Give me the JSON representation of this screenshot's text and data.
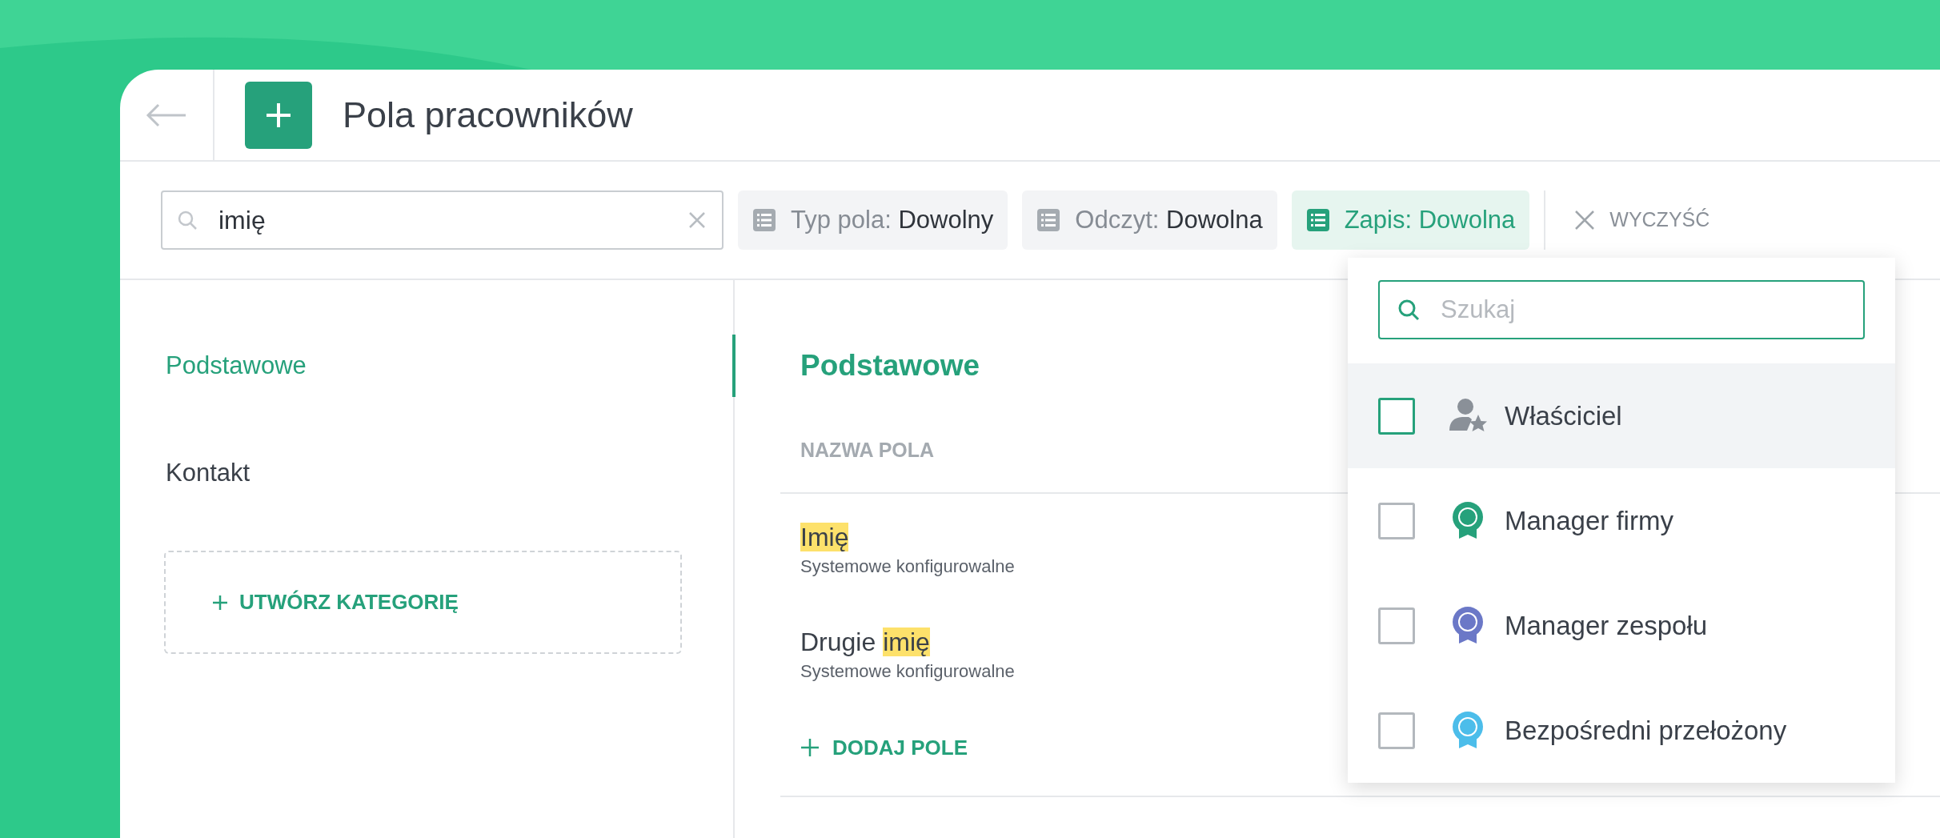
{
  "header": {
    "title": "Pola pracowników"
  },
  "filters": {
    "search": {
      "value": "imię"
    },
    "chips": [
      {
        "label": "Typ pola:",
        "value": "Dowolny",
        "active": false
      },
      {
        "label": "Odczyt:",
        "value": "Dowolna",
        "active": false
      },
      {
        "label": "Zapis:",
        "value": "Dowolna",
        "active": true
      }
    ],
    "clear": "WYCZYŚĆ"
  },
  "sidebar": {
    "items": [
      {
        "label": "Podstawowe",
        "selected": true
      },
      {
        "label": "Kontakt",
        "selected": false
      }
    ],
    "create": "UTWÓRZ KATEGORIĘ"
  },
  "section": {
    "title": "Podstawowe",
    "column": "NAZWA POLA",
    "rows": [
      {
        "name": [
          {
            "text": "Imię",
            "highlight": true
          }
        ],
        "subtitle": "Systemowe konfigurowalne"
      },
      {
        "name": [
          {
            "text": "Drugie ",
            "highlight": false
          },
          {
            "text": "imię",
            "highlight": true
          }
        ],
        "subtitle": "Systemowe konfigurowalne"
      }
    ],
    "add": "DODAJ POLE"
  },
  "dropdown": {
    "search": {
      "placeholder": "Szukaj"
    },
    "options": [
      {
        "label": "Właściciel",
        "kind": "owner",
        "color": "#8a9098",
        "checked": false,
        "highlighted": true
      },
      {
        "label": "Manager firmy",
        "kind": "badge",
        "color": "#26a17b",
        "checked": false,
        "highlighted": false
      },
      {
        "label": "Manager zespołu",
        "kind": "badge",
        "color": "#6b78c7",
        "checked": false,
        "highlighted": false
      },
      {
        "label": "Bezpośredni przełożony",
        "kind": "badge",
        "color": "#4cbdea",
        "checked": false,
        "highlighted": false
      }
    ]
  }
}
